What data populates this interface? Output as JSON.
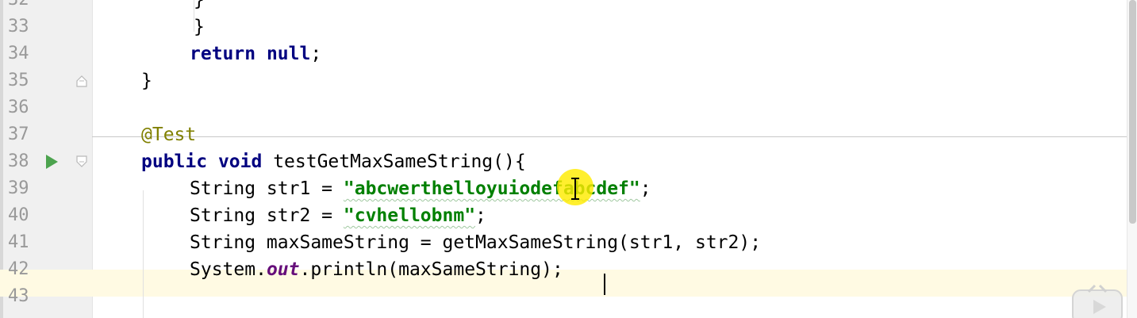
{
  "editor": {
    "lines": [
      {
        "number": "32",
        "tokens": [
          {
            "text": "}",
            "cls": ""
          }
        ]
      },
      {
        "number": "33",
        "tokens": [
          {
            "text": "}",
            "cls": ""
          }
        ]
      },
      {
        "number": "34",
        "tokens": [
          {
            "text": "return",
            "cls": "kw"
          },
          {
            "text": " ",
            "cls": ""
          },
          {
            "text": "null",
            "cls": "kw"
          },
          {
            "text": ";",
            "cls": ""
          }
        ]
      },
      {
        "number": "35",
        "tokens": [
          {
            "text": "}",
            "cls": ""
          }
        ]
      },
      {
        "number": "36",
        "tokens": []
      },
      {
        "number": "37",
        "tokens": [
          {
            "text": "@Test",
            "cls": "ann"
          }
        ]
      },
      {
        "number": "38",
        "tokens": [
          {
            "text": "public",
            "cls": "kw"
          },
          {
            "text": " ",
            "cls": ""
          },
          {
            "text": "void",
            "cls": "kw"
          },
          {
            "text": " testGetMaxSameString(){",
            "cls": ""
          }
        ]
      },
      {
        "number": "39",
        "tokens": [
          {
            "text": "String str1 = ",
            "cls": ""
          },
          {
            "text": "\"abcwerthelloyuiodefabcdef\"",
            "cls": "str squiggle"
          },
          {
            "text": ";",
            "cls": ""
          }
        ]
      },
      {
        "number": "40",
        "tokens": [
          {
            "text": "String str2 = ",
            "cls": ""
          },
          {
            "text": "\"cvhellobnm\"",
            "cls": "str squiggle"
          },
          {
            "text": ";",
            "cls": ""
          }
        ]
      },
      {
        "number": "41",
        "tokens": [
          {
            "text": "String maxSameString = getMaxSameString(str1, str2);",
            "cls": ""
          }
        ]
      },
      {
        "number": "42",
        "tokens": [
          {
            "text": "System.",
            "cls": ""
          },
          {
            "text": "out",
            "cls": "field"
          },
          {
            "text": ".println(maxSameString);",
            "cls": ""
          }
        ]
      },
      {
        "number": "43",
        "tokens": []
      }
    ]
  },
  "icons": {
    "run": "run-gutter-icon",
    "fold": "fold-marker-icon",
    "cursor": "text-cursor-icon",
    "player": "video-player-icon"
  },
  "colors": {
    "keyword": "#000080",
    "annotation": "#808000",
    "string": "#008000",
    "static_field": "#660e7a",
    "line_number": "#999999",
    "current_line": "#fffae3",
    "cursor_highlight": "#ffec00",
    "run_icon": "#4ca34e"
  }
}
